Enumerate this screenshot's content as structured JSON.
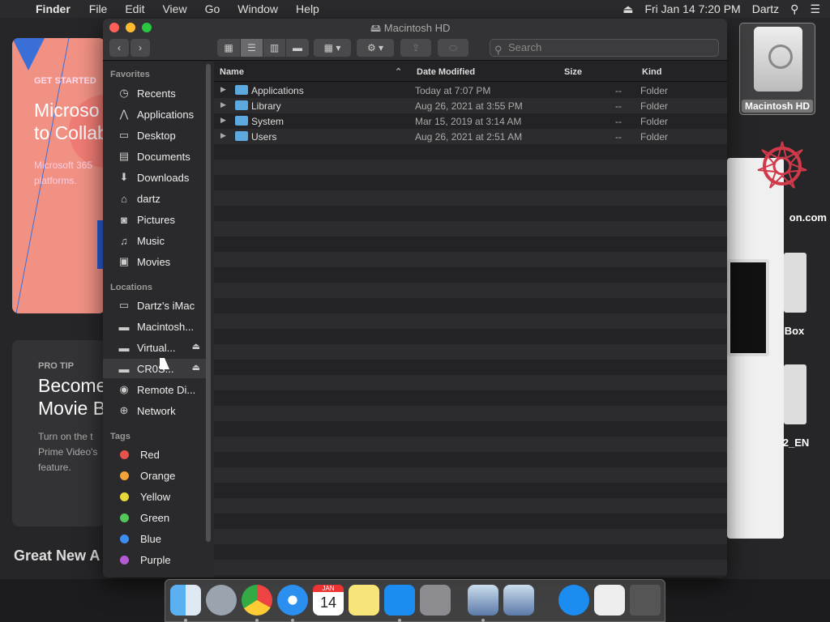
{
  "menubar": {
    "app": "Finder",
    "items": [
      "File",
      "Edit",
      "View",
      "Go",
      "Window",
      "Help"
    ],
    "datetime": "Fri Jan 14  7:20 PM",
    "user": "Dartz"
  },
  "background": {
    "card1_kicker": "GET STARTED",
    "card1_title": "Microso\nto Collab",
    "card1_sub": "Microsoft 365\nplatforms.",
    "card2_kicker": "PRO TIP",
    "card2_title": "Become\nMovie B",
    "card2_sub": "Turn on the t\nPrime Video's\nfeature.",
    "section": "Great New A",
    "desktop_hd": "Macintosh HD",
    "desktop_label2": "on.com",
    "desktop_label3": "Box",
    "desktop_label4": "2_EN"
  },
  "finder": {
    "title": "Macintosh HD",
    "search_placeholder": "Search",
    "favorites_label": "Favorites",
    "favorites": [
      {
        "label": "Recents",
        "icon": "clock-icon"
      },
      {
        "label": "Applications",
        "icon": "applications-icon"
      },
      {
        "label": "Desktop",
        "icon": "desktop-icon"
      },
      {
        "label": "Documents",
        "icon": "documents-icon"
      },
      {
        "label": "Downloads",
        "icon": "downloads-icon"
      },
      {
        "label": "dartz",
        "icon": "home-icon"
      },
      {
        "label": "Pictures",
        "icon": "camera-icon"
      },
      {
        "label": "Music",
        "icon": "music-icon"
      },
      {
        "label": "Movies",
        "icon": "movies-icon"
      }
    ],
    "locations_label": "Locations",
    "locations": [
      {
        "label": "Dartz's iMac",
        "icon": "imac-icon"
      },
      {
        "label": "Macintosh...",
        "icon": "disk-icon"
      },
      {
        "label": "Virtual...",
        "icon": "disk-icon"
      },
      {
        "label": "CR0S...",
        "icon": "disk-icon"
      },
      {
        "label": "Remote Di...",
        "icon": "disc-icon"
      },
      {
        "label": "Network",
        "icon": "network-icon"
      }
    ],
    "tags_label": "Tags",
    "tags": [
      {
        "label": "Red",
        "color": "#e5534b"
      },
      {
        "label": "Orange",
        "color": "#f2a33a"
      },
      {
        "label": "Yellow",
        "color": "#e8d93a"
      },
      {
        "label": "Green",
        "color": "#55c65a"
      },
      {
        "label": "Blue",
        "color": "#3d8ef0"
      },
      {
        "label": "Purple",
        "color": "#b35ad4"
      }
    ],
    "columns": {
      "name": "Name",
      "date": "Date Modified",
      "size": "Size",
      "kind": "Kind"
    },
    "files": [
      {
        "name": "Applications",
        "date": "Today at 7:07 PM",
        "size": "--",
        "kind": "Folder"
      },
      {
        "name": "Library",
        "date": "Aug 26, 2021 at 3:55 PM",
        "size": "--",
        "kind": "Folder"
      },
      {
        "name": "System",
        "date": "Mar 15, 2019 at 3:14 AM",
        "size": "--",
        "kind": "Folder"
      },
      {
        "name": "Users",
        "date": "Aug 26, 2021 at 2:51 AM",
        "size": "--",
        "kind": "Folder"
      }
    ]
  },
  "dock": {
    "calendar_month": "JAN",
    "calendar_day": "14"
  }
}
